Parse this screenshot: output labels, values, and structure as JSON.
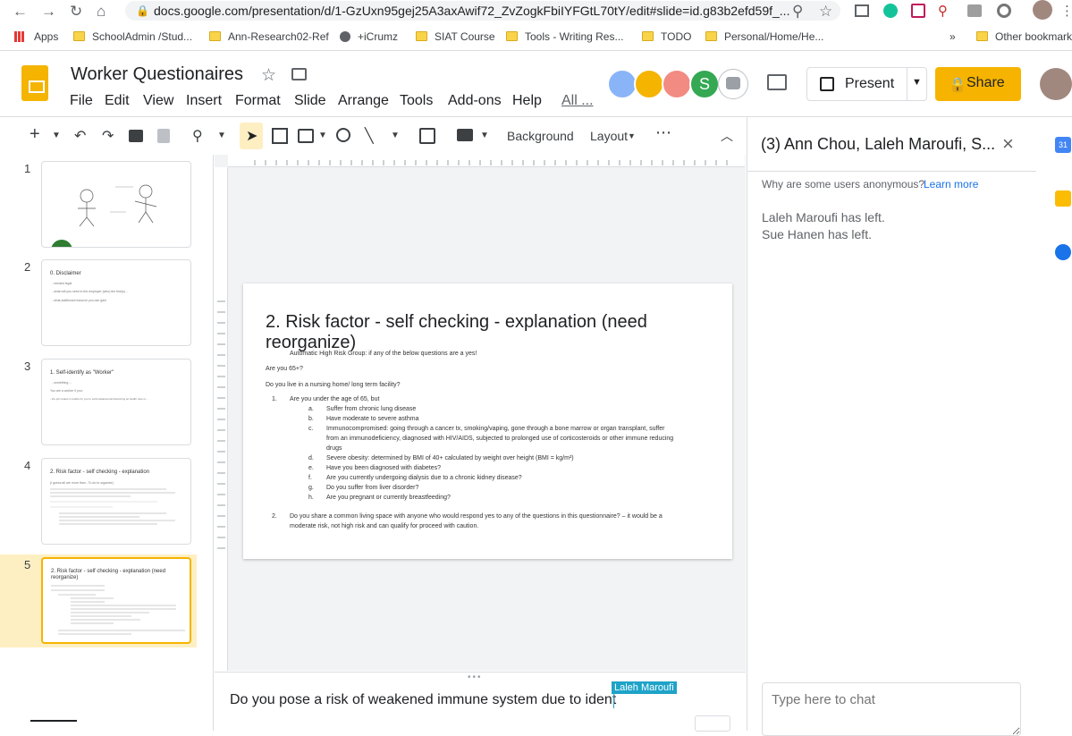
{
  "browser": {
    "url": "docs.google.com/presentation/d/1-GzUxn95gej25A3axAwif72_ZvZogkFbiIYFGtL70tY/edit#slide=id.g83b2efd59f_...",
    "bookmarks": [
      "Apps",
      "SchoolAdmin /Stud...",
      "Ann-Research02-Ref",
      "+iCrumz",
      "SIAT Course",
      "Tools - Writing Res...",
      "TODO",
      "Personal/Home/He..."
    ],
    "other_bookmarks": "Other bookmark",
    "overflow": "»"
  },
  "app": {
    "title": "Worker Questionaires",
    "menus": [
      "File",
      "Edit",
      "View",
      "Insert",
      "Format",
      "Slide",
      "Arrange",
      "Tools",
      "Add-ons",
      "Help",
      "All ..."
    ],
    "present_label": "Present",
    "share_label": "Share",
    "collab_initial": "S",
    "colors": {
      "slides_yellow": "#f4b400",
      "share_bg": "#f6b400",
      "selection_bg": "#feefc3",
      "cursor_label_bg": "#1fa3c8"
    }
  },
  "toolbar": {
    "background_label": "Background",
    "layout_label": "Layout"
  },
  "filmstrip": {
    "numbers": [
      "1",
      "2",
      "3",
      "4",
      "5"
    ],
    "thumb2": {
      "title": "0. Disclaimer",
      "lines": [
        "- needed legal",
        "- what will you need in the employer (who) the fine(s) ..",
        "- what additional resource you can gain"
      ]
    },
    "thumb3": {
      "title": "1. Self-identify as \"Worker\"",
      "lines": [
        "- something ...",
        "You are a worker if you:",
        "- the job makes it unable for you to self-isolate/social distancing as health care or..."
      ]
    },
    "thumb4": {
      "title": "2. Risk factor - self checking - explanation",
      "lines": [
        "(I guess all are more than - To do to organise)"
      ]
    },
    "thumb5": {
      "title": "2. Risk factor - self checking - explanation (need reorganize)"
    }
  },
  "slide": {
    "title": "2. Risk factor - self checking - explanation  (need reorganize)",
    "intro": "Automatic High Risk Group: if any of the below questions are a yes!",
    "q1": "Are you 65+?",
    "q2": "Do you live in a nursing home/ long term facility?",
    "item1_num": "1.",
    "item1": "Are you under the age of 65, but",
    "subitems": [
      {
        "label": "a.",
        "text": "Suffer from chronic lung disease"
      },
      {
        "label": "b.",
        "text": "Have moderate to severe asthma"
      },
      {
        "label": "c.",
        "text": "Immunocompromised: going through a cancer tx, smoking/vaping, gone through a bone marrow or organ transplant, suffer"
      },
      {
        "label": "",
        "text": "from an immunodeficiency, diagnosed with HIV/AIDS, subjected to prolonged use of corticosteroids or other immune reducing"
      },
      {
        "label": "",
        "text": "drugs"
      },
      {
        "label": "d.",
        "text": "Severe obesity: determined by BMI of 40+ calculated by weight over height (BMI = kg/m²)"
      },
      {
        "label": "e.",
        "text": "Have you been diagnosed with diabetes?"
      },
      {
        "label": "f.",
        "text": "Are you currently undergoing dialysis due to a chronic kidney disease?"
      },
      {
        "label": "g.",
        "text": "Do you suffer from liver disorder?"
      },
      {
        "label": "h.",
        "text": "Are you pregnant or currently breastfeeding?"
      }
    ],
    "item2_num": "2.",
    "item2_line1": "Do you share a common living space with anyone who would respond yes to any of the questions in this questionnaire? – it would be a",
    "item2_line2": "moderate risk, not high risk and can qualify for proceed with caution."
  },
  "notes": {
    "text": "Do you pose a risk of weakened immune system due to ident",
    "cursor_user": "Laleh Maroufi"
  },
  "chat": {
    "title": "(3) Ann Chou, Laleh Maroufi, S...",
    "anon_question": "Why are some users anonymous?",
    "learn_more": "Learn more",
    "messages": [
      "Laleh Maroufi has left.",
      "Sue Hanen has left."
    ],
    "input_placeholder": "Type here to chat"
  },
  "rail": {
    "calendar_day": "31"
  }
}
